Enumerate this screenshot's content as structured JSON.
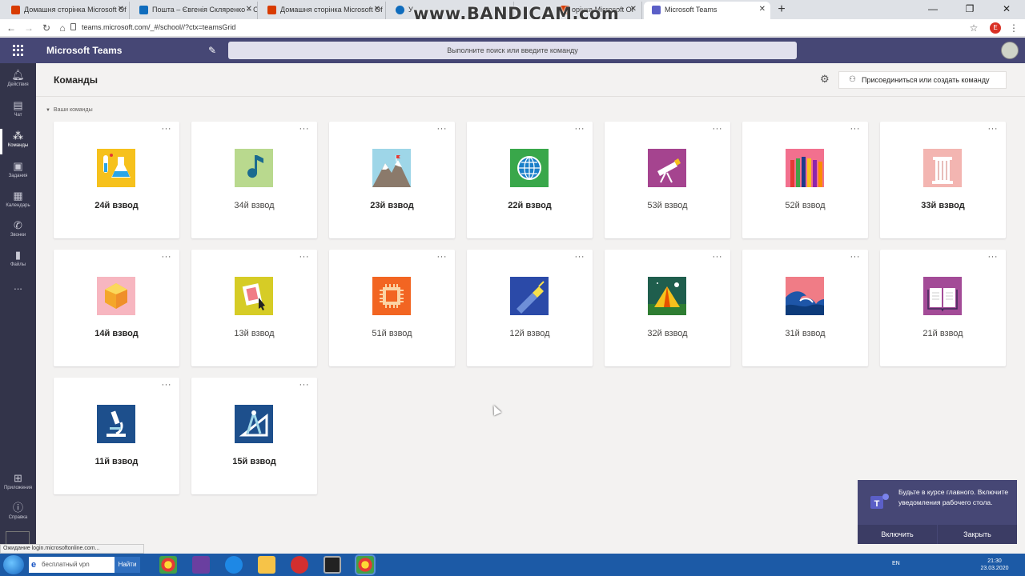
{
  "browser": {
    "tabs": [
      {
        "title": "Домашня сторінка Microsoft Of",
        "icon": "office-icon",
        "color": "#d83b01"
      },
      {
        "title": "Пошта – Євгенія Скляренко – О",
        "icon": "outlook-icon",
        "color": "#0f6cbd"
      },
      {
        "title": "Домашня сторінка Microsoft Of",
        "icon": "office-icon",
        "color": "#d83b01"
      },
      {
        "title": "У",
        "icon": "onedrive-icon",
        "color": "#0f6cbd"
      },
      {
        "title": "орінка Microsoft Of",
        "icon": "office-icon",
        "color": "#d83b01"
      },
      {
        "title": "Microsoft Teams",
        "icon": "teams-icon",
        "color": "#5b5fc7"
      }
    ],
    "new_tab": "+",
    "url": "teams.microsoft.com/_#/school//?ctx=teamsGrid",
    "profile_initial": "E",
    "watermark": "www.BANDICAM.com",
    "status_text": "Ожидание login.microsoftonline.com..."
  },
  "teams": {
    "app_title": "Microsoft Teams",
    "search_placeholder": "Выполните поиск или введите команду"
  },
  "rail": [
    {
      "label": "Действия",
      "icon": "bell-icon"
    },
    {
      "label": "Чат",
      "icon": "chat-icon"
    },
    {
      "label": "Команды",
      "icon": "teams-icon",
      "active": true
    },
    {
      "label": "Задания",
      "icon": "assignments-icon"
    },
    {
      "label": "Календарь",
      "icon": "calendar-icon"
    },
    {
      "label": "Звонки",
      "icon": "phone-icon"
    },
    {
      "label": "Файлы",
      "icon": "files-icon"
    },
    {
      "label": "...",
      "icon": "more-icon"
    },
    {
      "label": "Приложения",
      "icon": "apps-icon"
    },
    {
      "label": "Справка",
      "icon": "help-icon"
    }
  ],
  "page": {
    "title": "Команды",
    "join_button": "Присоединиться или создать команду",
    "section_label": "Ваши команды",
    "more_label": "···"
  },
  "teams_list": [
    {
      "name": "24й взвод",
      "bold": true,
      "logo": "science-icon",
      "bg": "#f6c11c"
    },
    {
      "name": "34й взвод",
      "bold": false,
      "logo": "music-note-icon",
      "bg": "#b9d98e"
    },
    {
      "name": "23й взвод",
      "bold": true,
      "logo": "mountain-icon",
      "bg": "#9ed6e8"
    },
    {
      "name": "22й взвод",
      "bold": true,
      "logo": "globe-icon",
      "bg": "#39a74a"
    },
    {
      "name": "53й взвод",
      "bold": false,
      "logo": "telescope-icon",
      "bg": "#a5448f"
    },
    {
      "name": "52й взвод",
      "bold": false,
      "logo": "pencils-icon",
      "bg": "#f2708e"
    },
    {
      "name": "33й взвод",
      "bold": true,
      "logo": "column-icon",
      "bg": "#f3b5b1"
    },
    {
      "name": "14й взвод",
      "bold": true,
      "logo": "polyhedron-icon",
      "bg": "#f7b6c0"
    },
    {
      "name": "13й взвод",
      "bold": false,
      "logo": "picture-icon",
      "bg": "#d6cc26"
    },
    {
      "name": "51й взвод",
      "bold": false,
      "logo": "chip-icon",
      "bg": "#f26522"
    },
    {
      "name": "12й взвод",
      "bold": false,
      "logo": "flashlight-icon",
      "bg": "#2b4aa8"
    },
    {
      "name": "32й взвод",
      "bold": false,
      "logo": "tent-icon",
      "bg": "#1f5e4d"
    },
    {
      "name": "31й взвод",
      "bold": false,
      "logo": "wave-icon",
      "bg": "#f07c86"
    },
    {
      "name": "21й взвод",
      "bold": false,
      "logo": "book-icon",
      "bg": "#a34b97"
    },
    {
      "name": "11й взвод",
      "bold": true,
      "logo": "microscope-icon",
      "bg": "#1d4f8c"
    },
    {
      "name": "15й взвод",
      "bold": true,
      "logo": "compass-icon",
      "bg": "#1d4f8c"
    }
  ],
  "toast": {
    "message": "Будьте в курсе главного. Включите уведомления рабочего стола.",
    "enable": "Включить",
    "close": "Закрыть"
  },
  "taskbar": {
    "search_text": "бесплатный vpn",
    "find_button": "Найти",
    "language": "EN",
    "time": "21:30",
    "date": "23.03.2020"
  }
}
